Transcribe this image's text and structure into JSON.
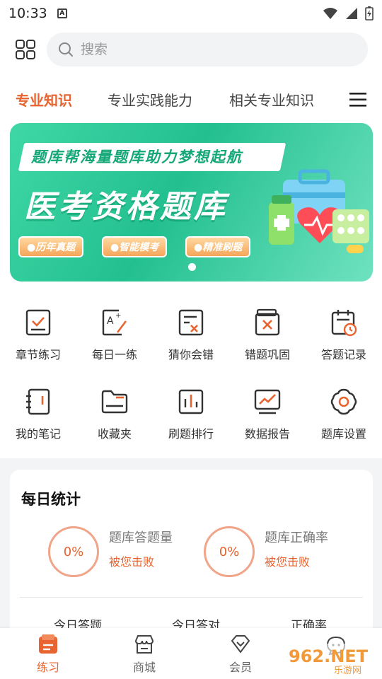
{
  "status": {
    "time": "10:33",
    "badge": "A"
  },
  "search": {
    "placeholder": "搜索"
  },
  "tabs": [
    {
      "label": "专业知识",
      "active": true
    },
    {
      "label": "专业实践能力",
      "active": false
    },
    {
      "label": "相关专业知识",
      "active": false
    }
  ],
  "banner": {
    "ribbon": "题库帮海量题库助力梦想起航",
    "headline": "医考资格题库",
    "chips": [
      "●历年真题",
      "●智能模考",
      "●精准刷题"
    ]
  },
  "features": [
    {
      "label": "章节练习",
      "icon": "chapter-practice-icon"
    },
    {
      "label": "每日一练",
      "icon": "daily-practice-icon"
    },
    {
      "label": "猜你会错",
      "icon": "guess-wrong-icon"
    },
    {
      "label": "错题巩固",
      "icon": "wrong-review-icon"
    },
    {
      "label": "答题记录",
      "icon": "answer-record-icon"
    },
    {
      "label": "我的笔记",
      "icon": "notes-icon"
    },
    {
      "label": "收藏夹",
      "icon": "favorites-icon"
    },
    {
      "label": "刷题排行",
      "icon": "ranking-icon"
    },
    {
      "label": "数据报告",
      "icon": "data-report-icon"
    },
    {
      "label": "题库设置",
      "icon": "settings-icon"
    }
  ],
  "stats": {
    "title": "每日统计",
    "items": [
      {
        "value": "0%",
        "label": "题库答题量",
        "sub": "被您击败"
      },
      {
        "value": "0%",
        "label": "题库正确率",
        "sub": "被您击败"
      }
    ],
    "columns": [
      "今日答题",
      "今日答对",
      "正确率"
    ]
  },
  "nav": [
    {
      "label": "练习",
      "active": true
    },
    {
      "label": "商城",
      "active": false
    },
    {
      "label": "会员",
      "active": false
    }
  ],
  "watermark": {
    "text": "962.NET",
    "sub": "乐游网"
  },
  "colors": {
    "accent": "#e8632f",
    "banner": "#23c08f"
  }
}
